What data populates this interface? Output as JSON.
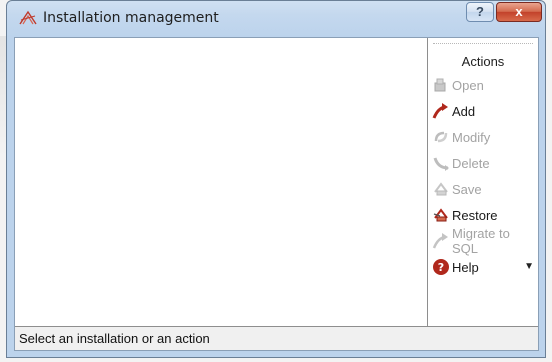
{
  "window": {
    "title": "Installation management",
    "help_glyph": "?",
    "close_glyph": "x"
  },
  "actions": {
    "title": "Actions",
    "items": [
      {
        "label": "Open",
        "enabled": false,
        "icon": "folder-icon"
      },
      {
        "label": "Add",
        "enabled": true,
        "icon": "add-arrow-icon"
      },
      {
        "label": "Modify",
        "enabled": false,
        "icon": "modify-icon"
      },
      {
        "label": "Delete",
        "enabled": false,
        "icon": "delete-icon"
      },
      {
        "label": "Save",
        "enabled": false,
        "icon": "save-icon"
      },
      {
        "label": "Restore",
        "enabled": true,
        "icon": "restore-icon"
      },
      {
        "label": "Migrate to SQL",
        "enabled": false,
        "icon": "migrate-icon"
      },
      {
        "label": "Help",
        "enabled": true,
        "icon": "help-icon",
        "has_dropdown": true
      }
    ]
  },
  "status": {
    "text": "Select an installation or an action"
  },
  "colors": {
    "accent_red": "#b0281c",
    "disabled_text": "#a3a3a3"
  }
}
